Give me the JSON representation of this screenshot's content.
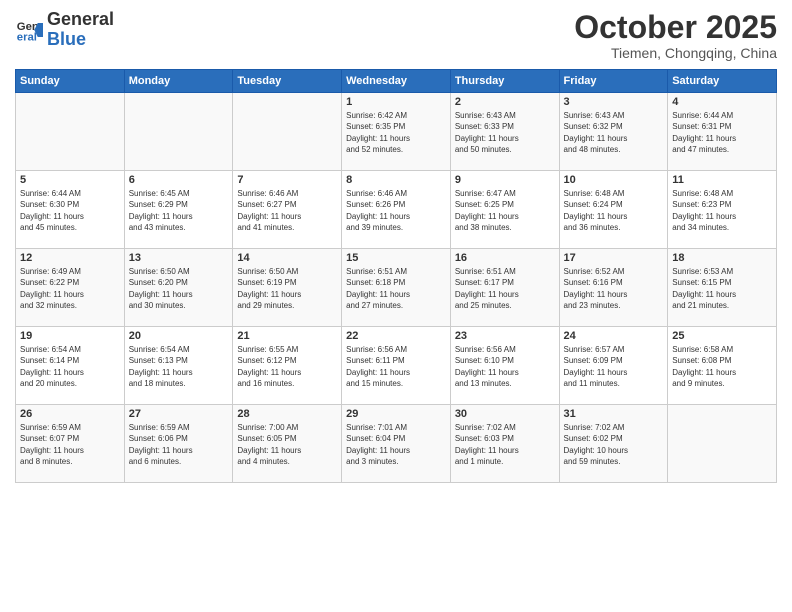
{
  "header": {
    "logo_general": "General",
    "logo_blue": "Blue",
    "month_title": "October 2025",
    "location": "Tiemen, Chongqing, China"
  },
  "weekdays": [
    "Sunday",
    "Monday",
    "Tuesday",
    "Wednesday",
    "Thursday",
    "Friday",
    "Saturday"
  ],
  "weeks": [
    [
      {
        "day": "",
        "info": ""
      },
      {
        "day": "",
        "info": ""
      },
      {
        "day": "",
        "info": ""
      },
      {
        "day": "1",
        "info": "Sunrise: 6:42 AM\nSunset: 6:35 PM\nDaylight: 11 hours\nand 52 minutes."
      },
      {
        "day": "2",
        "info": "Sunrise: 6:43 AM\nSunset: 6:33 PM\nDaylight: 11 hours\nand 50 minutes."
      },
      {
        "day": "3",
        "info": "Sunrise: 6:43 AM\nSunset: 6:32 PM\nDaylight: 11 hours\nand 48 minutes."
      },
      {
        "day": "4",
        "info": "Sunrise: 6:44 AM\nSunset: 6:31 PM\nDaylight: 11 hours\nand 47 minutes."
      }
    ],
    [
      {
        "day": "5",
        "info": "Sunrise: 6:44 AM\nSunset: 6:30 PM\nDaylight: 11 hours\nand 45 minutes."
      },
      {
        "day": "6",
        "info": "Sunrise: 6:45 AM\nSunset: 6:29 PM\nDaylight: 11 hours\nand 43 minutes."
      },
      {
        "day": "7",
        "info": "Sunrise: 6:46 AM\nSunset: 6:27 PM\nDaylight: 11 hours\nand 41 minutes."
      },
      {
        "day": "8",
        "info": "Sunrise: 6:46 AM\nSunset: 6:26 PM\nDaylight: 11 hours\nand 39 minutes."
      },
      {
        "day": "9",
        "info": "Sunrise: 6:47 AM\nSunset: 6:25 PM\nDaylight: 11 hours\nand 38 minutes."
      },
      {
        "day": "10",
        "info": "Sunrise: 6:48 AM\nSunset: 6:24 PM\nDaylight: 11 hours\nand 36 minutes."
      },
      {
        "day": "11",
        "info": "Sunrise: 6:48 AM\nSunset: 6:23 PM\nDaylight: 11 hours\nand 34 minutes."
      }
    ],
    [
      {
        "day": "12",
        "info": "Sunrise: 6:49 AM\nSunset: 6:22 PM\nDaylight: 11 hours\nand 32 minutes."
      },
      {
        "day": "13",
        "info": "Sunrise: 6:50 AM\nSunset: 6:20 PM\nDaylight: 11 hours\nand 30 minutes."
      },
      {
        "day": "14",
        "info": "Sunrise: 6:50 AM\nSunset: 6:19 PM\nDaylight: 11 hours\nand 29 minutes."
      },
      {
        "day": "15",
        "info": "Sunrise: 6:51 AM\nSunset: 6:18 PM\nDaylight: 11 hours\nand 27 minutes."
      },
      {
        "day": "16",
        "info": "Sunrise: 6:51 AM\nSunset: 6:17 PM\nDaylight: 11 hours\nand 25 minutes."
      },
      {
        "day": "17",
        "info": "Sunrise: 6:52 AM\nSunset: 6:16 PM\nDaylight: 11 hours\nand 23 minutes."
      },
      {
        "day": "18",
        "info": "Sunrise: 6:53 AM\nSunset: 6:15 PM\nDaylight: 11 hours\nand 21 minutes."
      }
    ],
    [
      {
        "day": "19",
        "info": "Sunrise: 6:54 AM\nSunset: 6:14 PM\nDaylight: 11 hours\nand 20 minutes."
      },
      {
        "day": "20",
        "info": "Sunrise: 6:54 AM\nSunset: 6:13 PM\nDaylight: 11 hours\nand 18 minutes."
      },
      {
        "day": "21",
        "info": "Sunrise: 6:55 AM\nSunset: 6:12 PM\nDaylight: 11 hours\nand 16 minutes."
      },
      {
        "day": "22",
        "info": "Sunrise: 6:56 AM\nSunset: 6:11 PM\nDaylight: 11 hours\nand 15 minutes."
      },
      {
        "day": "23",
        "info": "Sunrise: 6:56 AM\nSunset: 6:10 PM\nDaylight: 11 hours\nand 13 minutes."
      },
      {
        "day": "24",
        "info": "Sunrise: 6:57 AM\nSunset: 6:09 PM\nDaylight: 11 hours\nand 11 minutes."
      },
      {
        "day": "25",
        "info": "Sunrise: 6:58 AM\nSunset: 6:08 PM\nDaylight: 11 hours\nand 9 minutes."
      }
    ],
    [
      {
        "day": "26",
        "info": "Sunrise: 6:59 AM\nSunset: 6:07 PM\nDaylight: 11 hours\nand 8 minutes."
      },
      {
        "day": "27",
        "info": "Sunrise: 6:59 AM\nSunset: 6:06 PM\nDaylight: 11 hours\nand 6 minutes."
      },
      {
        "day": "28",
        "info": "Sunrise: 7:00 AM\nSunset: 6:05 PM\nDaylight: 11 hours\nand 4 minutes."
      },
      {
        "day": "29",
        "info": "Sunrise: 7:01 AM\nSunset: 6:04 PM\nDaylight: 11 hours\nand 3 minutes."
      },
      {
        "day": "30",
        "info": "Sunrise: 7:02 AM\nSunset: 6:03 PM\nDaylight: 11 hours\nand 1 minute."
      },
      {
        "day": "31",
        "info": "Sunrise: 7:02 AM\nSunset: 6:02 PM\nDaylight: 10 hours\nand 59 minutes."
      },
      {
        "day": "",
        "info": ""
      }
    ]
  ]
}
